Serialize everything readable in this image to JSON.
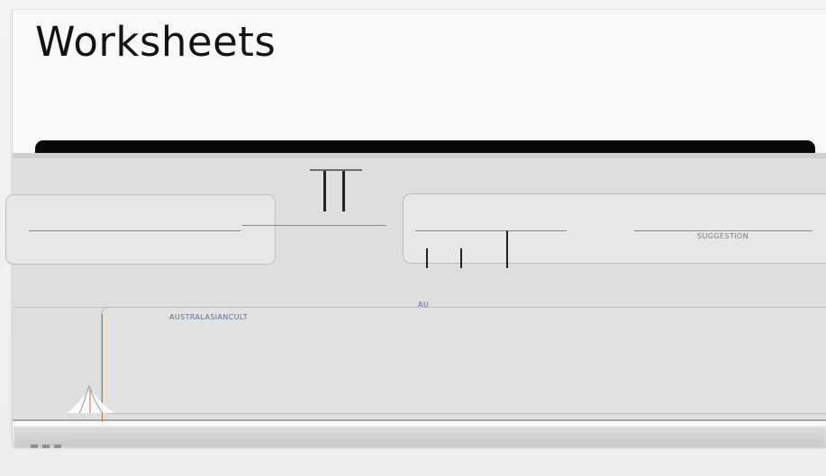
{
  "window": {
    "title": "Worksheets"
  },
  "panel": {
    "caption_blue": "AUSTRALASIANCULT",
    "small_blue": "AU",
    "right_box_text": "SUGGESTION"
  },
  "footer": {
    "dots": [
      "",
      "",
      ""
    ]
  },
  "colors": {
    "accent": "#c46f3d",
    "blue_text": "#5c6c95",
    "dark_bar": "#080808"
  }
}
